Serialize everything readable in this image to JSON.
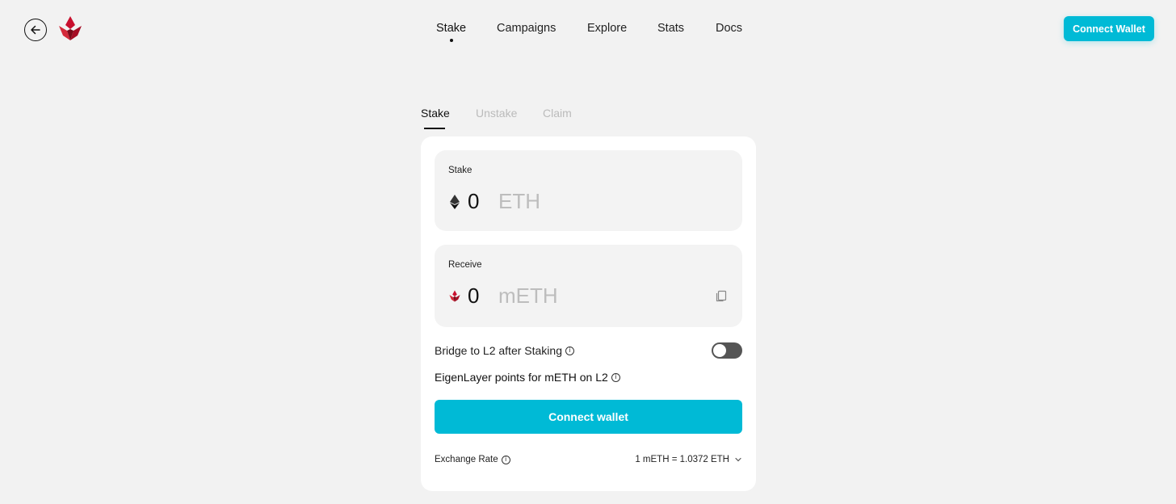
{
  "header": {
    "nav": [
      {
        "label": "Stake",
        "active": true
      },
      {
        "label": "Campaigns",
        "active": false
      },
      {
        "label": "Explore",
        "active": false
      },
      {
        "label": "Stats",
        "active": false
      },
      {
        "label": "Docs",
        "active": false
      }
    ],
    "connect_label": "Connect Wallet"
  },
  "tabs": [
    {
      "label": "Stake",
      "active": true
    },
    {
      "label": "Unstake",
      "active": false
    },
    {
      "label": "Claim",
      "active": false
    }
  ],
  "stake_panel": {
    "label": "Stake",
    "amount": "0",
    "unit": "ETH",
    "icon": "eth-icon"
  },
  "receive_panel": {
    "label": "Receive",
    "amount": "0",
    "unit": "mETH",
    "icon": "mantle-logo-icon"
  },
  "bridge": {
    "label": "Bridge to L2 after Staking",
    "enabled": false
  },
  "eigen": {
    "label": "EigenLayer points for mETH on L2"
  },
  "connect_wallet": {
    "label": "Connect wallet"
  },
  "exchange_rate": {
    "label": "Exchange Rate",
    "value": "1 mETH = 1.0372 ETH"
  },
  "colors": {
    "accent": "#00bad6",
    "brand": "#c8102e",
    "background": "#f2f2f2"
  }
}
